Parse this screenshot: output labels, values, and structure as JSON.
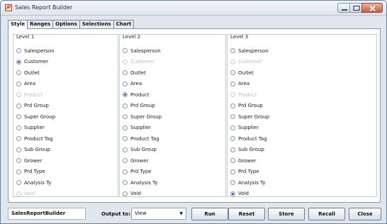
{
  "window": {
    "title": "Sales Report Builder"
  },
  "tabs": [
    {
      "label": "Style",
      "active": true
    },
    {
      "label": "Ranges",
      "active": false
    },
    {
      "label": "Options",
      "active": false
    },
    {
      "label": "Selections",
      "active": false
    },
    {
      "label": "Chart",
      "active": false
    }
  ],
  "levels": [
    {
      "title": "Level 1",
      "options": [
        {
          "label": "Salesperson",
          "selected": false,
          "disabled": false
        },
        {
          "label": "Customer",
          "selected": true,
          "disabled": false
        },
        {
          "label": "Outlet",
          "selected": false,
          "disabled": false
        },
        {
          "label": "Area",
          "selected": false,
          "disabled": false
        },
        {
          "label": "Product",
          "selected": false,
          "disabled": true
        },
        {
          "label": "Prd Group",
          "selected": false,
          "disabled": false
        },
        {
          "label": "Super Group",
          "selected": false,
          "disabled": false
        },
        {
          "label": "Supplier",
          "selected": false,
          "disabled": false
        },
        {
          "label": "Product Tag",
          "selected": false,
          "disabled": false
        },
        {
          "label": "Sub Group",
          "selected": false,
          "disabled": false
        },
        {
          "label": "Grower",
          "selected": false,
          "disabled": false
        },
        {
          "label": "Prd Type",
          "selected": false,
          "disabled": false
        },
        {
          "label": "Analysis Ty",
          "selected": false,
          "disabled": false
        },
        {
          "label": "Void",
          "selected": false,
          "disabled": true
        }
      ]
    },
    {
      "title": "Level 2",
      "options": [
        {
          "label": "Salesperson",
          "selected": false,
          "disabled": false
        },
        {
          "label": "Customer",
          "selected": false,
          "disabled": true
        },
        {
          "label": "Outlet",
          "selected": false,
          "disabled": false
        },
        {
          "label": "Area",
          "selected": false,
          "disabled": false
        },
        {
          "label": "Product",
          "selected": true,
          "disabled": false
        },
        {
          "label": "Prd Group",
          "selected": false,
          "disabled": false
        },
        {
          "label": "Super Group",
          "selected": false,
          "disabled": false
        },
        {
          "label": "Supplier",
          "selected": false,
          "disabled": false
        },
        {
          "label": "Product Tag",
          "selected": false,
          "disabled": false
        },
        {
          "label": "Sub Group",
          "selected": false,
          "disabled": false
        },
        {
          "label": "Grower",
          "selected": false,
          "disabled": false
        },
        {
          "label": "Prd Type",
          "selected": false,
          "disabled": false
        },
        {
          "label": "Analysis Ty",
          "selected": false,
          "disabled": false
        },
        {
          "label": "Void",
          "selected": false,
          "disabled": false
        }
      ]
    },
    {
      "title": "Level 3",
      "options": [
        {
          "label": "Salesperson",
          "selected": false,
          "disabled": false
        },
        {
          "label": "Customer",
          "selected": false,
          "disabled": true
        },
        {
          "label": "Outlet",
          "selected": false,
          "disabled": false
        },
        {
          "label": "Area",
          "selected": false,
          "disabled": false
        },
        {
          "label": "Product",
          "selected": false,
          "disabled": true
        },
        {
          "label": "Prd Group",
          "selected": false,
          "disabled": false
        },
        {
          "label": "Super Group",
          "selected": false,
          "disabled": false
        },
        {
          "label": "Supplier",
          "selected": false,
          "disabled": false
        },
        {
          "label": "Product Tag",
          "selected": false,
          "disabled": false
        },
        {
          "label": "Sub Group",
          "selected": false,
          "disabled": false
        },
        {
          "label": "Grower",
          "selected": false,
          "disabled": false
        },
        {
          "label": "Prd Type",
          "selected": false,
          "disabled": false
        },
        {
          "label": "Analysis Ty",
          "selected": false,
          "disabled": false
        },
        {
          "label": "Void",
          "selected": true,
          "disabled": false
        }
      ]
    }
  ],
  "bottom": {
    "report_name": "SalesReportBuilder",
    "output_label": "Output to:",
    "output_value": "View",
    "run_label": "Run",
    "reset_label": "Reset",
    "store_label": "Store",
    "recall_label": "Recall",
    "close_label": "Close"
  },
  "colors": {
    "accent": "#1f4fa0",
    "disabled_text": "#b7bcc2",
    "close_button": "#c75c44"
  },
  "icons": {
    "app": "app-icon",
    "minimize": "minimize-icon",
    "maximize": "maximize-icon",
    "close": "close-icon",
    "dropdown": "chevron-down-icon"
  }
}
